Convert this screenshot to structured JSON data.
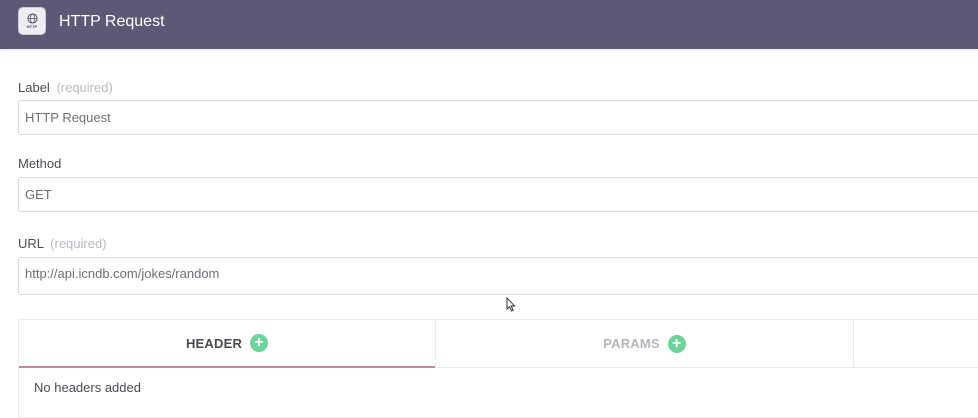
{
  "header": {
    "title": "HTTP Request",
    "icon": "http-globe-icon",
    "icon_text": "HTTP"
  },
  "form": {
    "label_field": {
      "label": "Label",
      "hint": "(required)",
      "value": "HTTP Request"
    },
    "method_field": {
      "label": "Method",
      "value": "GET"
    },
    "url_field": {
      "label": "URL",
      "hint": "(required)",
      "value": "http://api.icndb.com/jokes/random"
    }
  },
  "tabs": {
    "items": [
      {
        "label": "HEADER",
        "active": true
      },
      {
        "label": "PARAMS",
        "active": false
      }
    ],
    "empty_message": "No headers added"
  },
  "colors": {
    "header_bg": "#5e5877",
    "accent_underline": "#c88a98",
    "add_button": "#6ed39a"
  }
}
